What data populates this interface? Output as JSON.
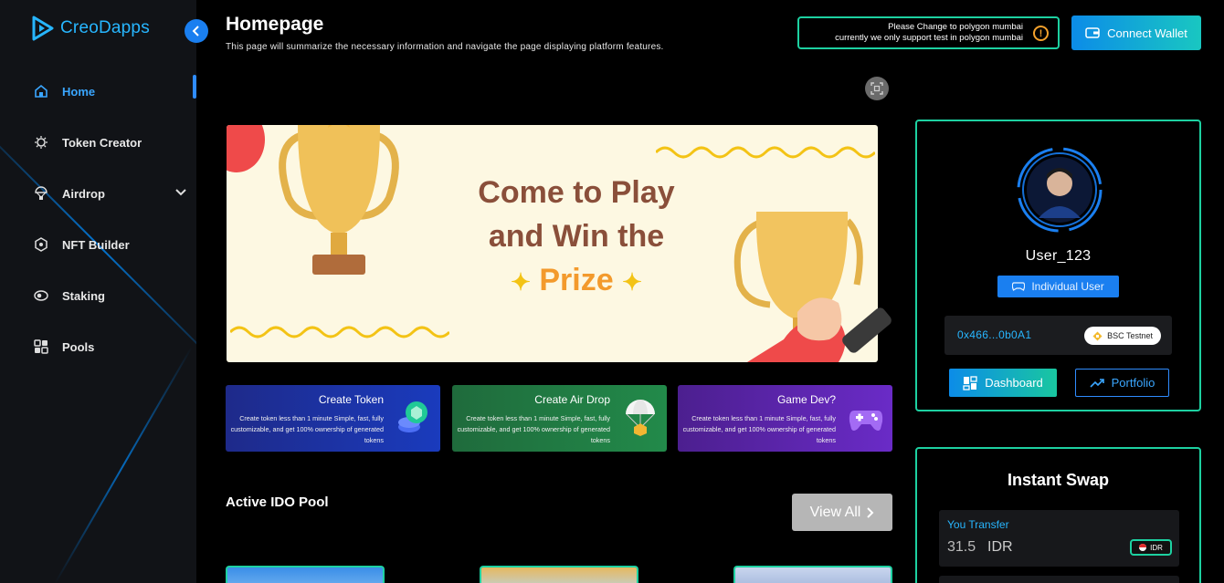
{
  "brand": {
    "name": "CreoDapps"
  },
  "sidebar": {
    "items": [
      {
        "label": "Home",
        "icon": "home-icon",
        "active": true
      },
      {
        "label": "Token Creator",
        "icon": "token-creator-icon",
        "active": false
      },
      {
        "label": "Airdrop",
        "icon": "airdrop-icon",
        "active": false,
        "expandable": true
      },
      {
        "label": "NFT Builder",
        "icon": "nft-builder-icon",
        "active": false
      },
      {
        "label": "Staking",
        "icon": "staking-icon",
        "active": false
      },
      {
        "label": "Pools",
        "icon": "pools-icon",
        "active": false
      }
    ]
  },
  "header": {
    "title": "Homepage",
    "subtitle": "This page will summarize the necessary information and navigate the page displaying platform features.",
    "notice_line1": "Please Change to polygon mumbai",
    "notice_line2": "currently we only support test in polygon mumbai",
    "connect_label": "Connect Wallet"
  },
  "banner": {
    "line1": "Come to Play",
    "line2": "and Win the",
    "line3": "Prize"
  },
  "feature_cards": [
    {
      "title": "Create Token",
      "description": "Create token less than 1 minute Simple, fast, fully customizable, and get 100% ownership of generated tokens"
    },
    {
      "title": "Create Air Drop",
      "description": "Create token less than 1 minute Simple, fast, fully customizable, and get 100% ownership of generated tokens"
    },
    {
      "title": "Game Dev?",
      "description": "Create token less than 1 minute Simple, fast, fully customizable, and get 100% ownership of generated tokens"
    }
  ],
  "ido": {
    "title": "Active IDO Pool",
    "view_all_label": "View All"
  },
  "profile": {
    "username": "User_123",
    "role_label": "Individual User",
    "address": "0x466...0b0A1",
    "network": "BSC Testnet",
    "dashboard_label": "Dashboard",
    "portfolio_label": "Portfolio"
  },
  "swap": {
    "title": "Instant Swap",
    "transfer_label": "You Transfer",
    "amount": "31.5",
    "currency": "IDR",
    "currency_pill": "IDR"
  },
  "colors": {
    "accent_blue": "#1a7ff0",
    "accent_teal": "#1dd1a1",
    "link_blue": "#27b6ff",
    "warning": "#f4a12c"
  }
}
